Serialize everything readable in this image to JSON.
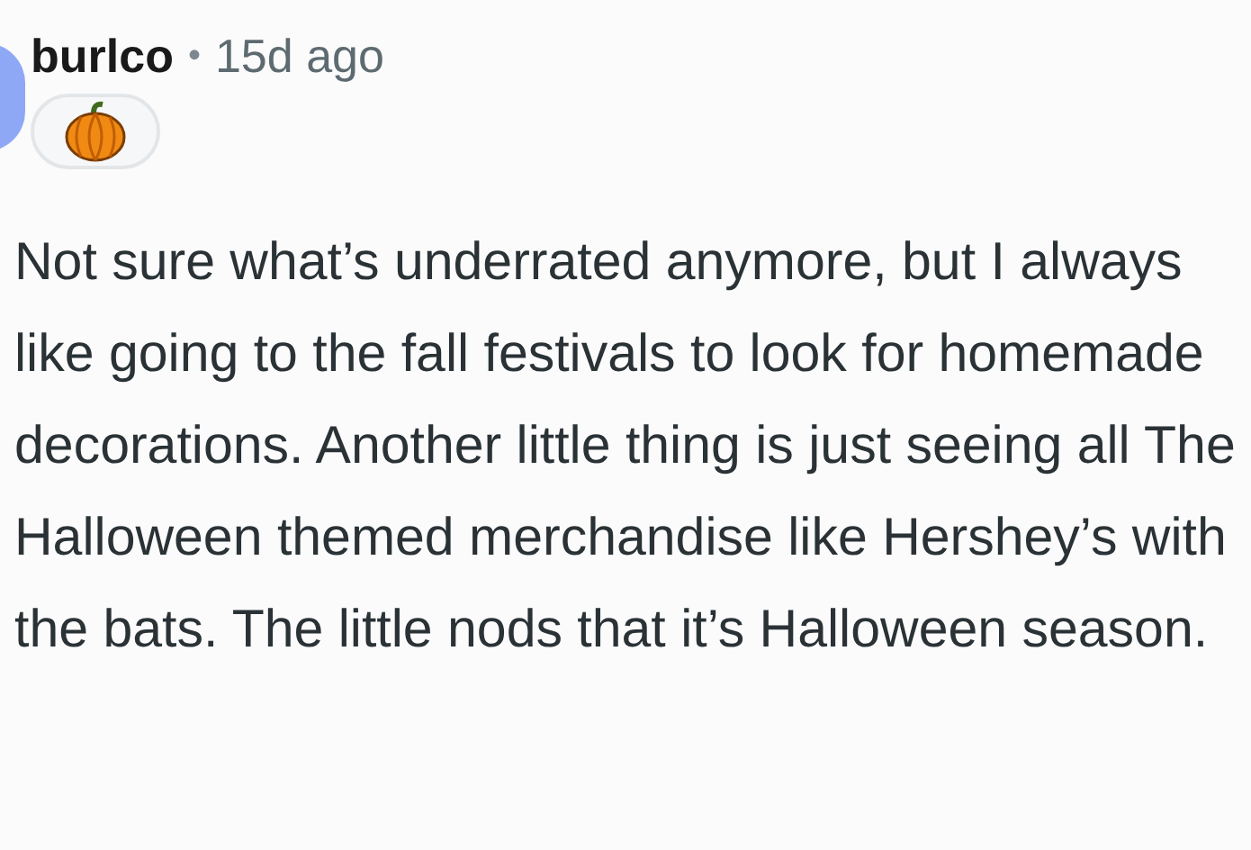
{
  "comment": {
    "author": "burlco",
    "separator": "•",
    "time": "15d ago",
    "body": "Not sure what’s underrated anymore, but I always like going to the fall festivals to look for homemade decorations. Another little thing is just seeing all The Halloween themed merchandise like Hershey’s with the bats. The little nods that it’s Halloween season."
  }
}
